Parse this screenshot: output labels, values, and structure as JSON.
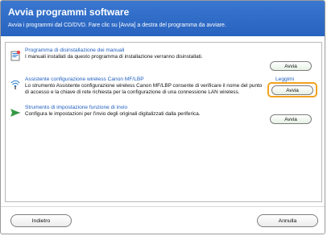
{
  "window": {
    "title": "Avvia programmi software",
    "subtitle": "Avvia i programmi dal CD/DVD. Fare clic su [Avvia] a destra del programma da avviare."
  },
  "items": [
    {
      "name": "Programma di disinstallazione dei manuali",
      "description": "I manuali installati da questo programma di installazione verranno disinstallati.",
      "button": "Avvia",
      "icon": "uninstall-manuals-icon"
    },
    {
      "name": "Assistente configurazione wireless Canon MF/LBP",
      "description": "Lo strumento Assistente configurazione wireless Canon MF/LBP consente di verificare il nome del punto di accesso e la chiave di rete richiesta per la configurazione di una connessione LAN wireless.",
      "button": "Avvia",
      "icon": "wireless-setup-icon",
      "side_label": "Leggimi"
    },
    {
      "name": "Strumento di impostazione funzione di invio",
      "description": "Configura le impostazioni per l'invio degli originali digitalizzati dalla periferica.",
      "button": "Avvia",
      "icon": "send-function-icon"
    }
  ],
  "footer": {
    "back": "Indietro",
    "cancel": "Annulla"
  },
  "colors": {
    "header": "#2f6bc8",
    "link": "#1f5ebf",
    "highlight": "#f2a320",
    "button_border": "#7d7d7d"
  }
}
